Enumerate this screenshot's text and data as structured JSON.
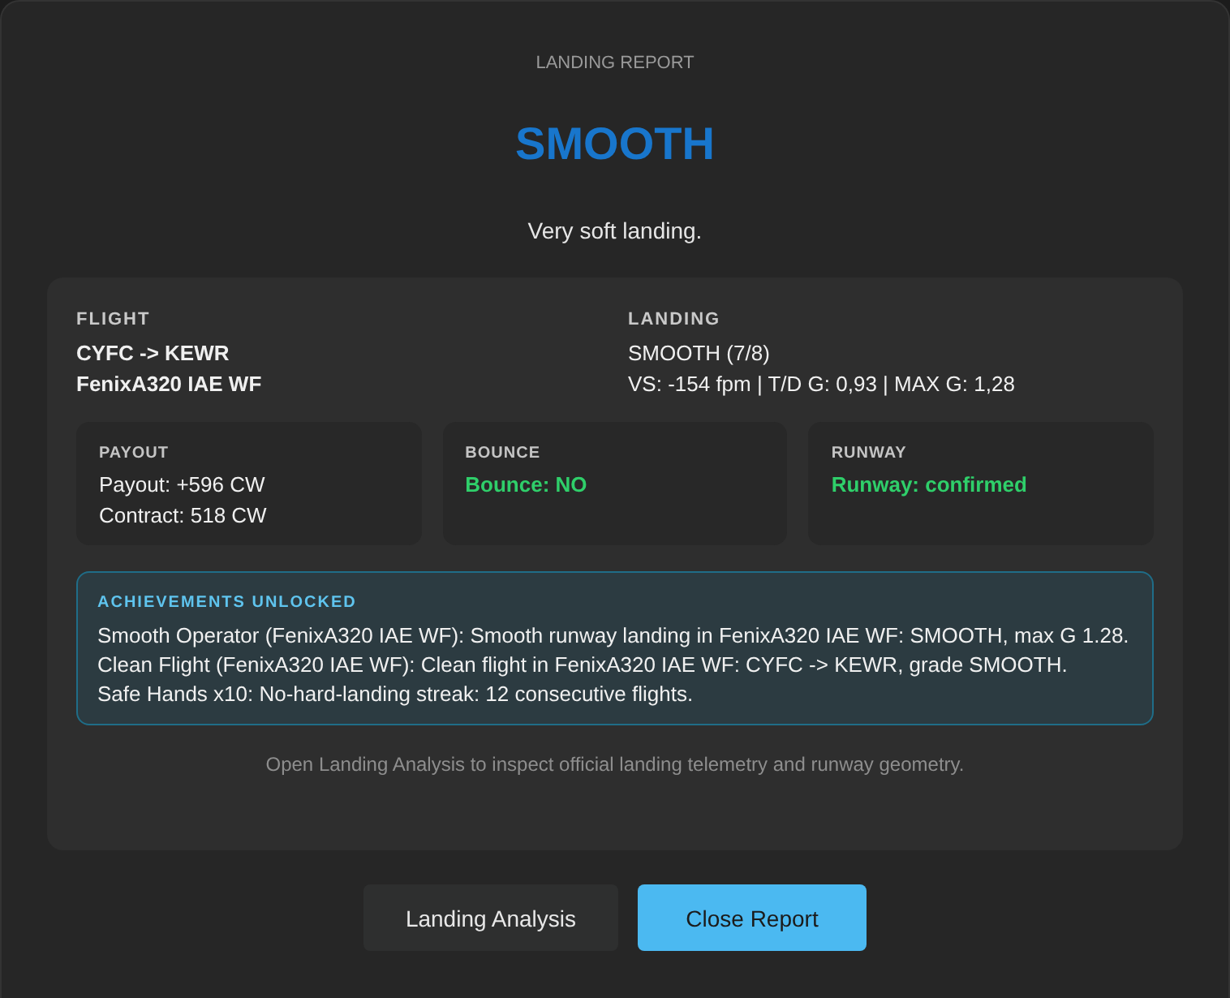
{
  "dialog": {
    "title": "LANDING REPORT",
    "grade": "SMOOTH",
    "summary": "Very soft landing."
  },
  "details": [
    {
      "label": "FLIGHT",
      "bold": true,
      "lines": [
        "CYFC -> KEWR",
        "FenixA320 IAE WF"
      ]
    },
    {
      "label": "LANDING",
      "bold": false,
      "lines": [
        "SMOOTH (7/8)",
        "VS: -154 fpm | T/D G: 0,93 | MAX G: 1,28"
      ]
    }
  ],
  "stats": [
    {
      "label": "PAYOUT",
      "lines": [
        {
          "text": "Payout: +596 CW",
          "highlight": false
        },
        {
          "text": "Contract: 518 CW",
          "highlight": false
        }
      ]
    },
    {
      "label": "BOUNCE",
      "lines": [
        {
          "text": "Bounce: NO",
          "highlight": true
        }
      ]
    },
    {
      "label": "RUNWAY",
      "lines": [
        {
          "text": "Runway: confirmed",
          "highlight": true
        }
      ]
    }
  ],
  "achievements": {
    "title": "ACHIEVEMENTS UNLOCKED",
    "items": [
      "Smooth Operator (FenixA320 IAE WF): Smooth runway landing in FenixA320 IAE WF: SMOOTH, max G 1.28.",
      "Clean Flight (FenixA320 IAE WF): Clean flight in FenixA320 IAE WF: CYFC -> KEWR, grade SMOOTH.",
      "Safe Hands x10: No-hard-landing streak: 12 consecutive flights."
    ]
  },
  "hint": "Open Landing Analysis to inspect official landing telemetry and runway geometry.",
  "buttons": [
    {
      "label": "Landing Analysis",
      "kind": "secondary"
    },
    {
      "label": "Close Report",
      "kind": "primary"
    }
  ]
}
